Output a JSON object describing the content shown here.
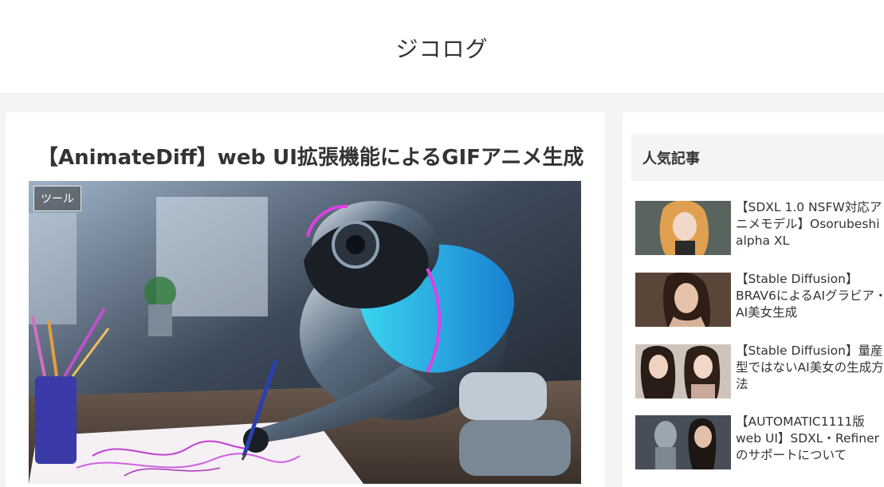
{
  "site": {
    "title": "ジコログ"
  },
  "article": {
    "title": "【AnimateDiff】web UI拡張機能によるGIFアニメ生成",
    "category": "ツール"
  },
  "sidebar": {
    "widget_title": "人気記事",
    "items": [
      {
        "title": "【SDXL 1.0 NSFW対応アニメモデル】Osorubeshi alpha XL"
      },
      {
        "title": "【Stable Diffusion】BRAV6によるAIグラビア・AI美女生成"
      },
      {
        "title": "【Stable Diffusion】量産型ではないAI美女の生成方法"
      },
      {
        "title": "【AUTOMATIC1111版web UI】SDXL・Refinerのサポートについて"
      }
    ]
  }
}
